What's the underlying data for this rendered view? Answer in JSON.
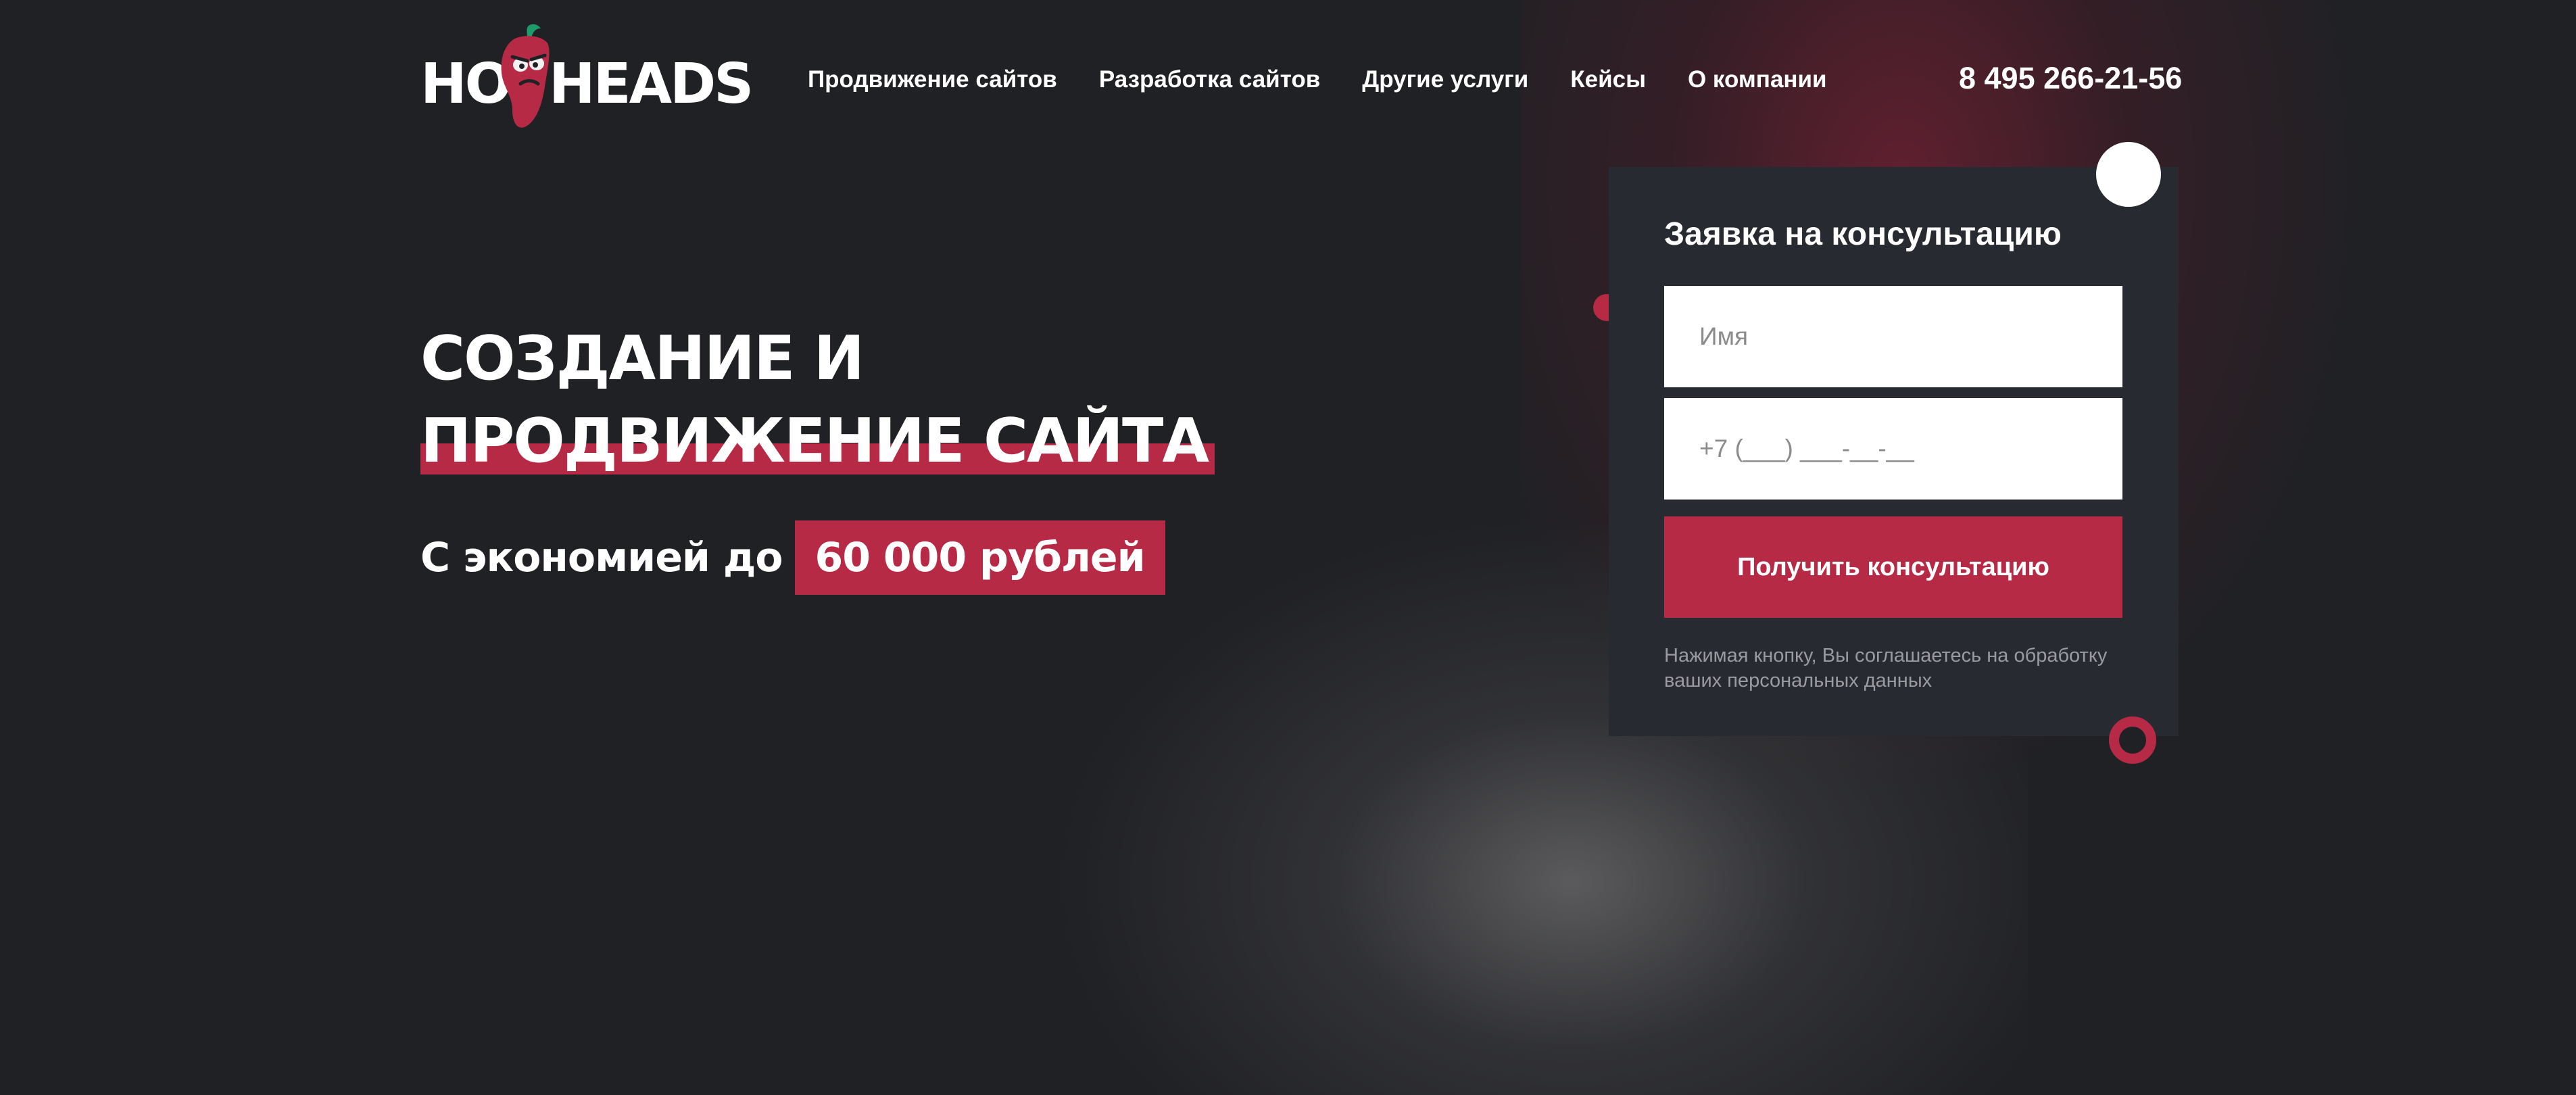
{
  "brand": {
    "logo_left": "HOT",
    "logo_right": "HEADS",
    "accent_color": "#b72a46",
    "background_color": "#202125"
  },
  "nav": {
    "items": [
      {
        "label": "Продвижение сайтов"
      },
      {
        "label": "Разработка сайтов"
      },
      {
        "label": "Другие услуги"
      },
      {
        "label": "Кейсы"
      },
      {
        "label": "О компании"
      }
    ]
  },
  "phone": "8 495 266-21-56",
  "hero": {
    "title_line1": "СОЗДАНИЕ И",
    "title_line2": "ПРОДВИЖЕНИЕ САЙТА",
    "subtitle_prefix": "С экономией до",
    "subtitle_highlight": "60 000 рублей"
  },
  "form": {
    "title": "Заявка на консультацию",
    "name_placeholder": "Имя",
    "phone_placeholder": "+7 (___) ___-__-__",
    "submit_label": "Получить консультацию",
    "consent_text": "Нажимая кнопку, Вы соглашаетесь на обработку ваших персональных данных"
  },
  "icons": {
    "logo_mascot": "chili-pepper-icon"
  }
}
